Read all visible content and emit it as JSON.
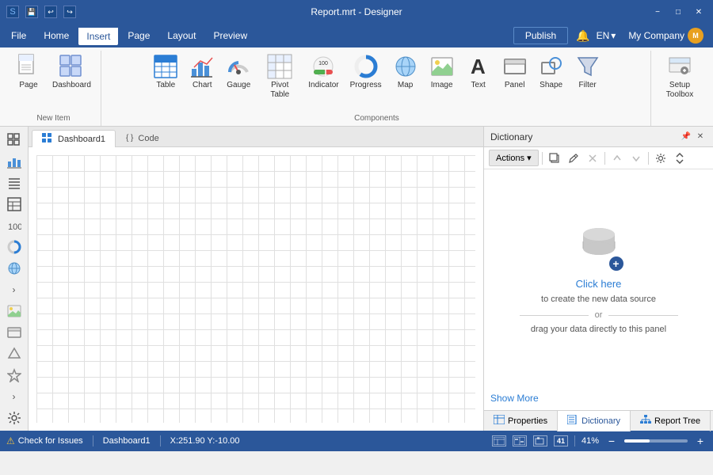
{
  "titleBar": {
    "title": "Report.mrt - Designer",
    "saveIcon": "💾",
    "undoIcon": "↩",
    "redoIcon": "↪",
    "minBtn": "−",
    "maxBtn": "□",
    "closeBtn": "✕"
  },
  "menuBar": {
    "items": [
      "File",
      "Home",
      "Insert",
      "Page",
      "Layout",
      "Preview"
    ],
    "activeItem": "Insert",
    "publishLabel": "Publish",
    "langLabel": "EN",
    "companyLabel": "My Company",
    "avatarInitial": "M"
  },
  "ribbon": {
    "newItemLabel": "New Item",
    "componentsLabel": "Components",
    "items": [
      {
        "id": "page",
        "label": "Page",
        "icon": "page"
      },
      {
        "id": "dashboard",
        "label": "Dashboard",
        "icon": "dashboard"
      },
      {
        "id": "table",
        "label": "Table",
        "icon": "table"
      },
      {
        "id": "chart",
        "label": "Chart",
        "icon": "chart"
      },
      {
        "id": "gauge",
        "label": "Gauge",
        "icon": "gauge"
      },
      {
        "id": "pivot",
        "label": "Pivot\nTable",
        "icon": "pivot"
      },
      {
        "id": "indicator",
        "label": "Indicator",
        "icon": "indicator"
      },
      {
        "id": "progress",
        "label": "Progress",
        "icon": "progress"
      },
      {
        "id": "map",
        "label": "Map",
        "icon": "map"
      },
      {
        "id": "image",
        "label": "Image",
        "icon": "image"
      },
      {
        "id": "text",
        "label": "Text",
        "icon": "text"
      },
      {
        "id": "panel",
        "label": "Panel",
        "icon": "panel"
      },
      {
        "id": "shape",
        "label": "Shape",
        "icon": "shape"
      },
      {
        "id": "filter",
        "label": "Filter",
        "icon": "filter"
      },
      {
        "id": "setup",
        "label": "Setup\nToolbox",
        "icon": "setup"
      }
    ]
  },
  "tabs": [
    {
      "id": "dashboard1",
      "label": "Dashboard1",
      "icon": "🖥",
      "active": true
    },
    {
      "id": "code",
      "label": "Code",
      "icon": "{ }",
      "active": false
    }
  ],
  "leftSidebar": {
    "buttons": [
      "⊞",
      "📊",
      "≡",
      "〓",
      "💯",
      "◯",
      "🌐",
      "›",
      "🖼",
      "▭",
      "⬡",
      "✦",
      "›",
      "⚙"
    ]
  },
  "dictionary": {
    "title": "Dictionary",
    "pinIcon": "📌",
    "closeIcon": "✕",
    "actionsLabel": "Actions",
    "dropdownIcon": "▾",
    "toolbarBtns": [
      "📋",
      "🖊",
      "✕",
      "↑",
      "↓",
      "⚙"
    ],
    "clickHereText": "Click here",
    "subtitleText": "to create the new data source",
    "orText": "or",
    "dragText": "drag your data directly to this panel",
    "showMoreLabel": "Show More"
  },
  "bottomTabs": [
    {
      "id": "properties",
      "label": "Properties",
      "icon": "⊟",
      "active": false
    },
    {
      "id": "dictionary",
      "label": "Dictionary",
      "icon": "📚",
      "active": true
    },
    {
      "id": "reporttree",
      "label": "Report Tree",
      "icon": "🌲",
      "active": false
    }
  ],
  "statusBar": {
    "checkIssues": "Check for Issues",
    "dashboard": "Dashboard1",
    "coords": "X:251.90 Y:-10.00",
    "zoom": "41%",
    "warningIcon": "⚠"
  }
}
